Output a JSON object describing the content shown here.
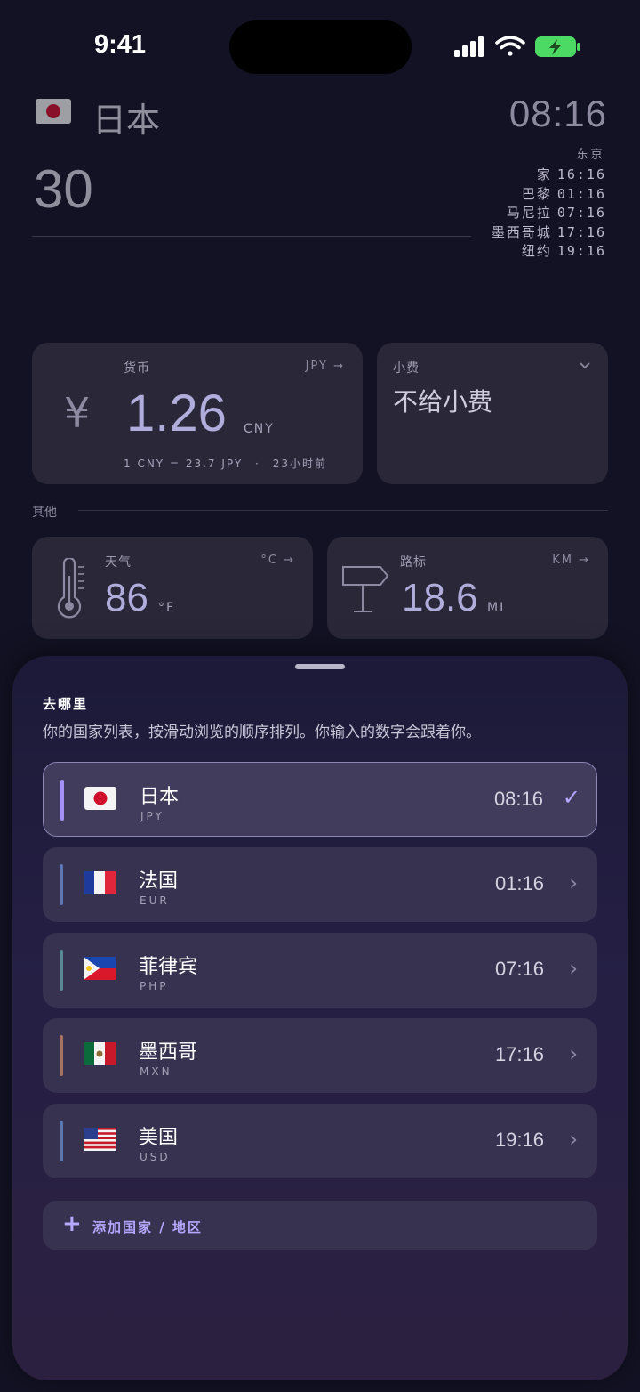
{
  "status_bar": {
    "time": "9:41"
  },
  "header": {
    "country": "日本",
    "amount": "30",
    "clock": "08:16",
    "city": "东京",
    "zones": [
      {
        "label": "家",
        "time": "16:16"
      },
      {
        "label": "巴黎",
        "time": "01:16"
      },
      {
        "label": "马尼拉",
        "time": "07:16"
      },
      {
        "label": "墨西哥城",
        "time": "17:16"
      },
      {
        "label": "纽约",
        "time": "19:16"
      }
    ]
  },
  "currency_card": {
    "label": "货币",
    "unit": "JPY →",
    "symbol": "¥",
    "value": "1.26",
    "value_unit": "CNY",
    "rate": "1 CNY = 23.7 JPY",
    "dot": "·",
    "updated": "23小时前"
  },
  "tip_card": {
    "label": "小费",
    "value": "不给小费"
  },
  "section_other": "其他",
  "weather_card": {
    "label": "天气",
    "unit": "°C →",
    "value": "86",
    "value_unit": "°F"
  },
  "sign_card": {
    "label": "路标",
    "unit": "KM →",
    "value": "18.6",
    "value_unit": "MI"
  },
  "sheet": {
    "title": "去哪里",
    "subtitle": "你的国家列表，按滑动浏览的顺序排列。你输入的数字会跟着你。",
    "rows": [
      {
        "name": "日本",
        "code": "JPY",
        "time": "08:16",
        "selected": true,
        "bar_color": "#a391f5",
        "flag": "japan-flag-icon"
      },
      {
        "name": "法国",
        "code": "EUR",
        "time": "01:16",
        "selected": false,
        "bar_color": "#5f78b5",
        "flag": "france-flag-icon"
      },
      {
        "name": "菲律宾",
        "code": "PHP",
        "time": "07:16",
        "selected": false,
        "bar_color": "#5a8a93",
        "flag": "philippines-flag-icon"
      },
      {
        "name": "墨西哥",
        "code": "MXN",
        "time": "17:16",
        "selected": false,
        "bar_color": "#a77360",
        "flag": "mexico-flag-icon"
      },
      {
        "name": "美国",
        "code": "USD",
        "time": "19:16",
        "selected": false,
        "bar_color": "#5b77b0",
        "flag": "usa-flag-icon"
      }
    ],
    "add_label": "添加国家 / 地区",
    "check": "✓",
    "chevron": "›",
    "plus": "+"
  }
}
